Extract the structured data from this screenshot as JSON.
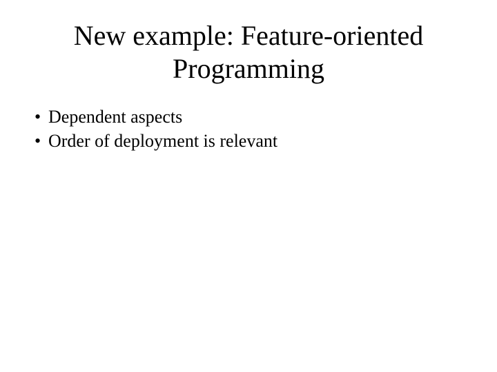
{
  "slide": {
    "title": "New example: Feature-oriented Programming",
    "bullets": [
      "Dependent aspects",
      "Order of deployment is relevant"
    ],
    "bullet_char": "•"
  }
}
